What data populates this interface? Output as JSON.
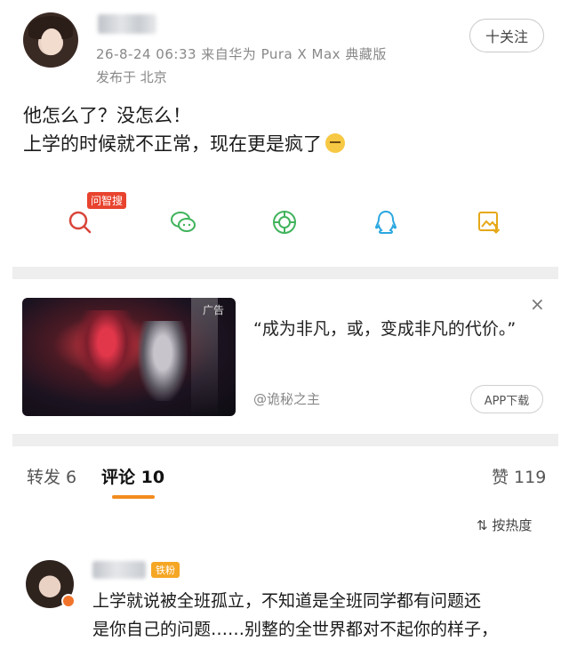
{
  "post": {
    "meta": "26-8-24 06:33  来自华为 Pura X Max 典藏版",
    "location": "发布于 北京",
    "follow_label": "十关注",
    "text_line1": "他怎么了？没怎么！",
    "text_line2": "上学的时候就不正常，现在更是疯了"
  },
  "share": {
    "smart_search_badge": "问智搜",
    "items": [
      {
        "icon": "smart-search-icon",
        "color": "#d8453a"
      },
      {
        "icon": "wechat-icon",
        "color": "#41b35d"
      },
      {
        "icon": "moments-icon",
        "color": "#41b35d"
      },
      {
        "icon": "qq-icon",
        "color": "#2aa7e0"
      },
      {
        "icon": "save-image-icon",
        "color": "#e6a817"
      }
    ]
  },
  "ad": {
    "tag": "广告",
    "title": "“成为非凡，或，变成非凡的代价。”",
    "source": "@诡秘之主",
    "button_label": "APP下载",
    "close_label": "×"
  },
  "tabs": {
    "repost": "转发 6",
    "comments": "评论 10",
    "likes": "赞 119",
    "sort_label": "按热度",
    "accent": "#f28b1d"
  },
  "comment": {
    "badge": "铁粉",
    "text_line1": "上学就说被全班孤立，不知道是全班同学都有问题还",
    "text_line2": "是你自己的问题……别整的全世界都对不起你的样子，",
    "text_line3": "……"
  }
}
